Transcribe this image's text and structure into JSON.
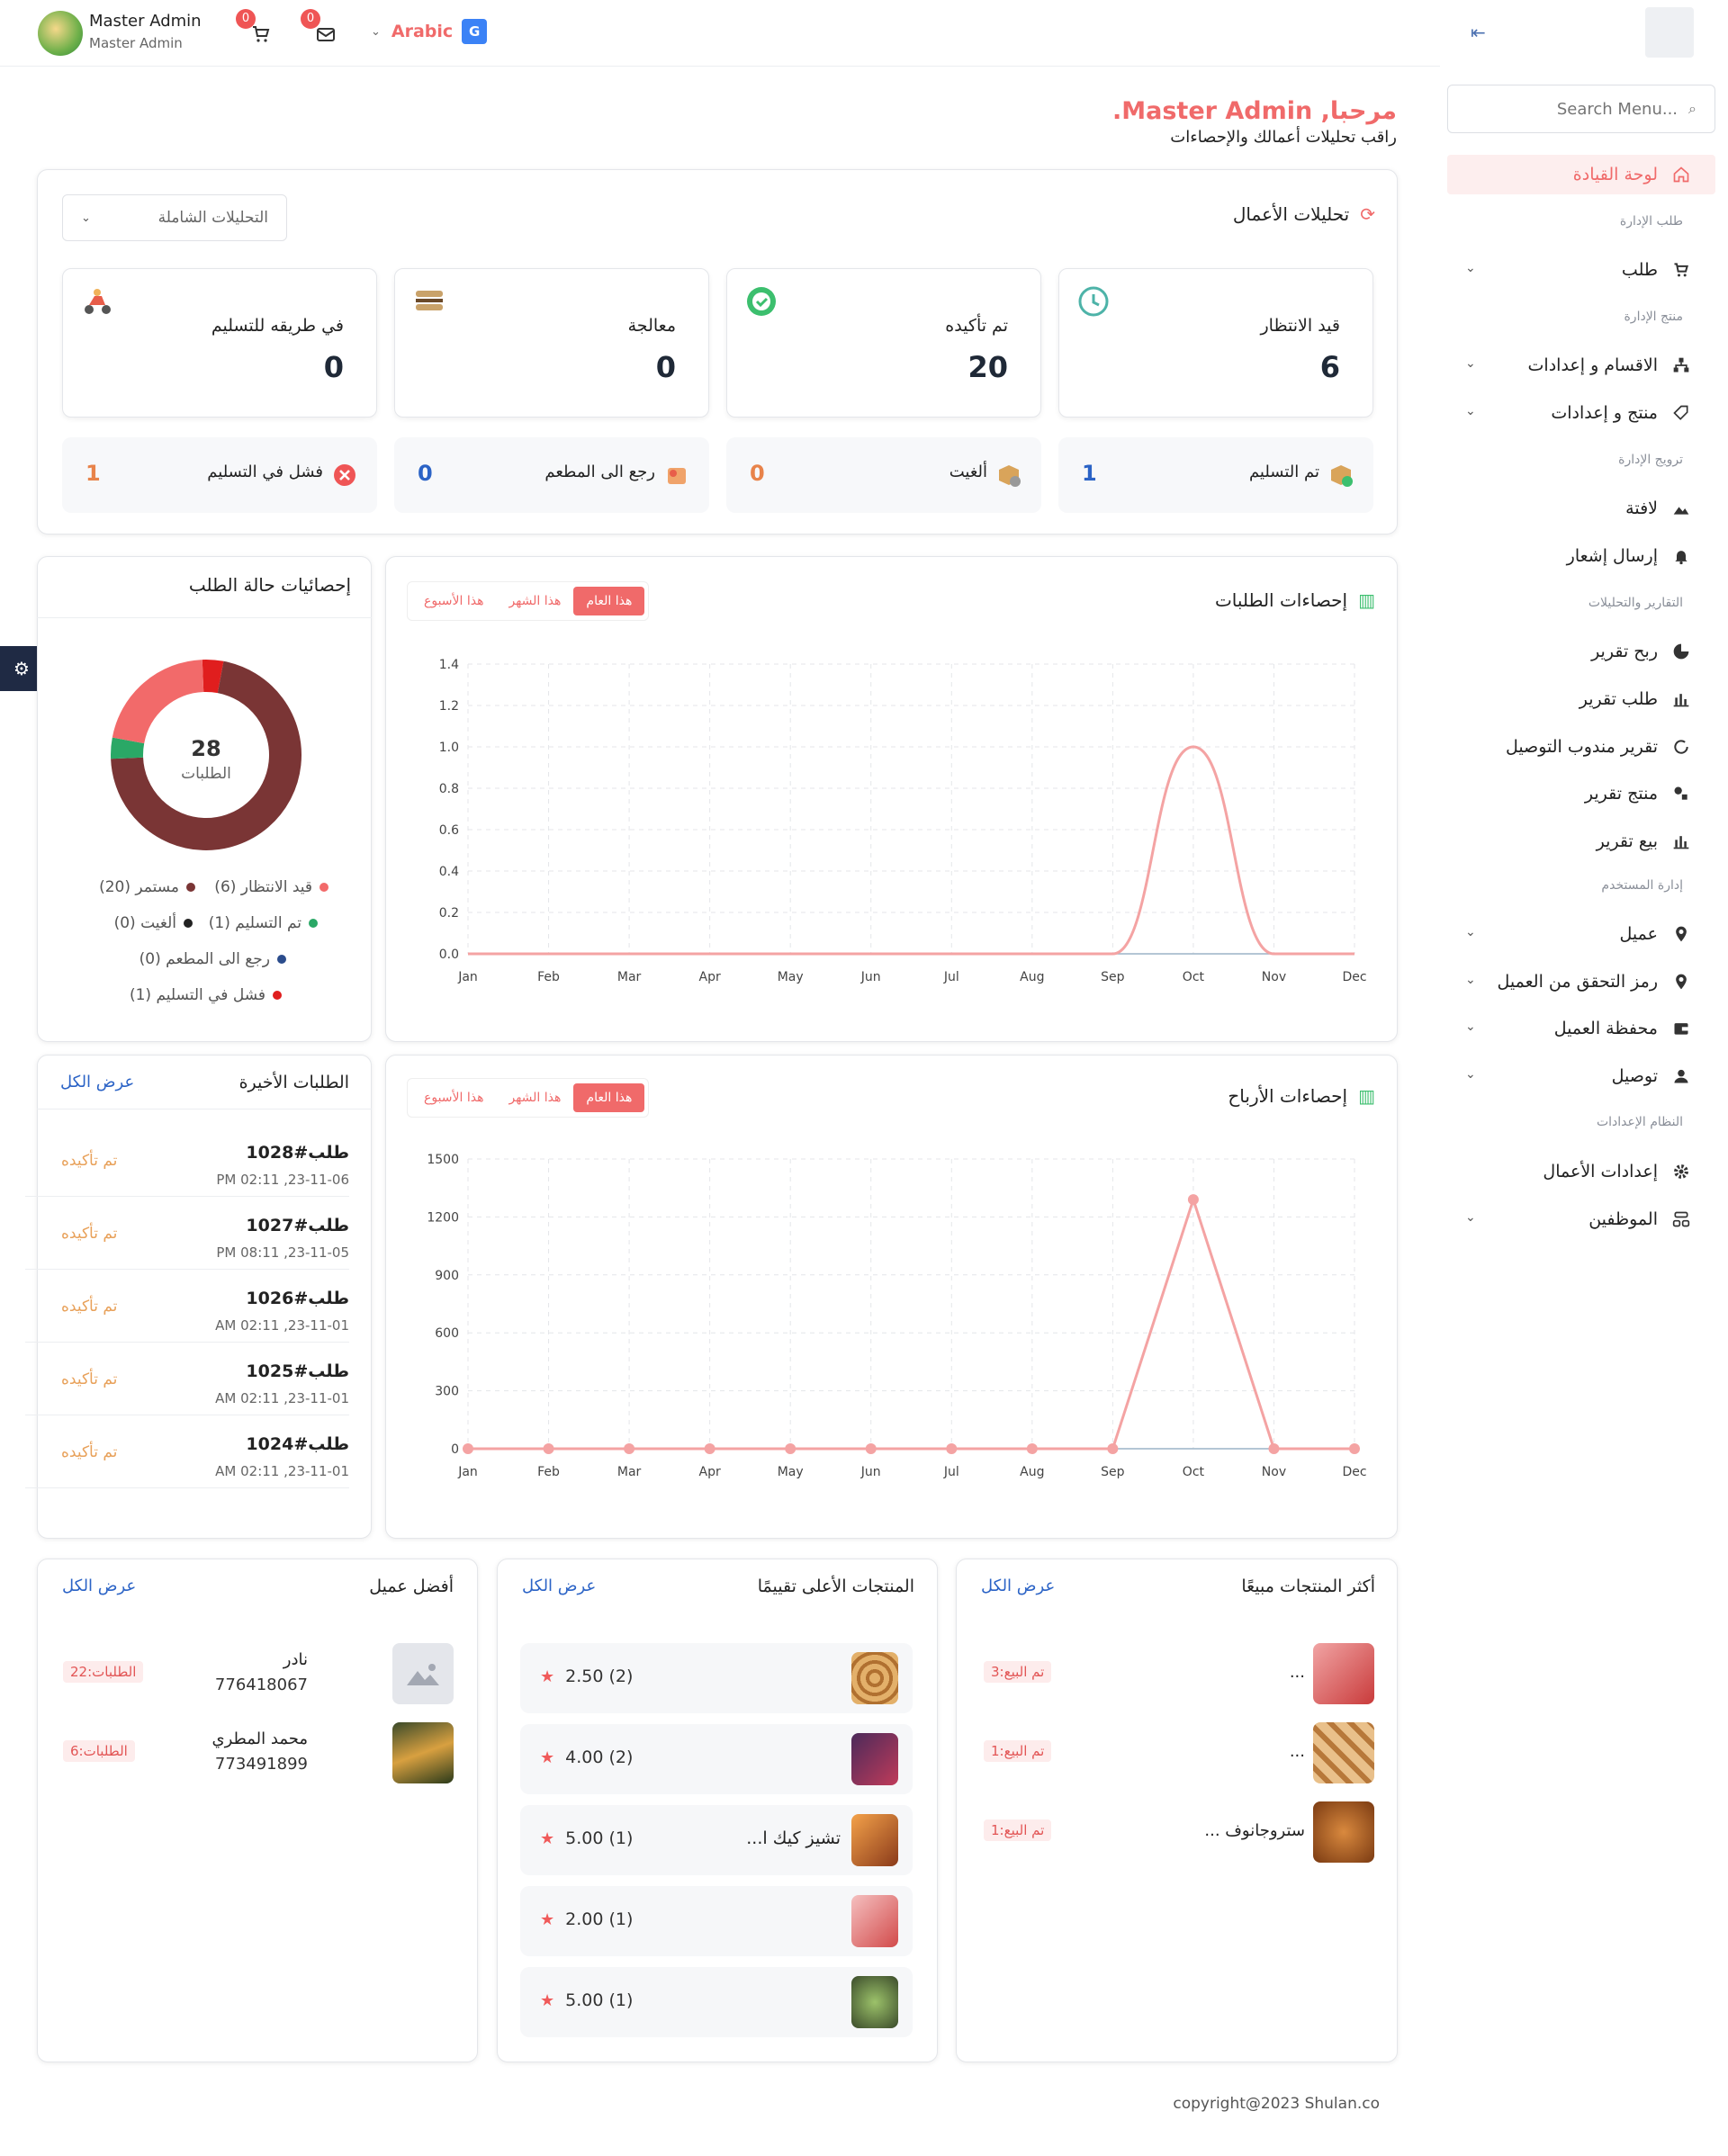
{
  "header": {
    "user_name": "Master Admin",
    "user_role": "Master Admin",
    "cart_count": "0",
    "message_count": "0",
    "language": "Arabic"
  },
  "sidebar": {
    "search_placeholder": "Search Menu...",
    "dashboard": "لوحة القيادة",
    "sections": {
      "orders": "طلب الإدارة",
      "products": "منتج الإدارة",
      "promo": "ترويج الإدارة",
      "reports": "التقارير والتحليلات",
      "users": "إدارة المستخدم",
      "system": "النظام الإعدادات"
    },
    "items": {
      "order": "طلب",
      "categories": "الاقسام و إعدادات",
      "product": "منتج و إعدادات",
      "banner": "لافتة",
      "notify": "إرسال إشعار",
      "profit_report": "ربح تقرير",
      "order_report": "طلب تقرير",
      "delivery_report": "تقرير مندوب التوصيل",
      "product_report": "منتج تقرير",
      "sale_report": "بيع تقرير",
      "customer": "عميل",
      "verify": "رمز التحقق من العميل",
      "wallet": "محفظة العميل",
      "delivery": "توصيل",
      "business_settings": "إعدادات الأعمال",
      "employees": "الموظفين"
    }
  },
  "welcome": {
    "greeting": "مرحبا, Master Admin.",
    "subtitle": "راقب تحليلات أعمالك والإحصاءات"
  },
  "analytics": {
    "title": "تحليلات الأعمال",
    "filter": "التحليلات الشاملة",
    "stats": [
      {
        "label": "قيد الانتظار",
        "value": "6"
      },
      {
        "label": "تم تأكيده",
        "value": "20"
      },
      {
        "label": "معالجة",
        "value": "0"
      },
      {
        "label": "في طريقه للتسليم",
        "value": "0"
      }
    ],
    "mini": [
      {
        "label": "تم التسليم",
        "value": "1",
        "color": "#2b63c6"
      },
      {
        "label": "ألغيت",
        "value": "0",
        "color": "#e8834a"
      },
      {
        "label": "رجع الى المطعم",
        "value": "0",
        "color": "#2b63c6"
      },
      {
        "label": "فشل في التسليم",
        "value": "1",
        "color": "#e8834a"
      }
    ]
  },
  "tabs": {
    "year": "هذا العام",
    "month": "هذا الشهر",
    "week": "هذا الأسبوع"
  },
  "orders_chart_title": "إحصاءات الطلبات",
  "profit_chart_title": "إحصاءات الأرباح",
  "chart_data": [
    {
      "type": "line",
      "x": [
        "Jan",
        "Feb",
        "Mar",
        "Apr",
        "May",
        "Jun",
        "Jul",
        "Aug",
        "Sep",
        "Oct",
        "Nov",
        "Dec"
      ],
      "series": [
        {
          "values": [
            0,
            0,
            0,
            0,
            0,
            0,
            0,
            0,
            0,
            1,
            0,
            0
          ],
          "color": "#f4a3a3"
        }
      ],
      "ylim": [
        0,
        1.4
      ],
      "yticks": [
        "0.0",
        "0.2",
        "0.4",
        "0.6",
        "0.8",
        "1.0",
        "1.2",
        "1.4"
      ],
      "smooth": true
    },
    {
      "type": "line",
      "x": [
        "Jan",
        "Feb",
        "Mar",
        "Apr",
        "May",
        "Jun",
        "Jul",
        "Aug",
        "Sep",
        "Oct",
        "Nov",
        "Dec"
      ],
      "series": [
        {
          "values": [
            0,
            0,
            0,
            0,
            0,
            0,
            0,
            0,
            0,
            1290,
            0,
            0
          ],
          "color": "#f4a3a3"
        }
      ],
      "ylim": [
        0,
        1500
      ],
      "yticks": [
        "0",
        "300",
        "600",
        "900",
        "1200",
        "1500"
      ],
      "smooth": false
    },
    {
      "type": "pie",
      "title": "إحصائيات حالة الطلب",
      "total": "28",
      "total_label": "الطلبات",
      "slices": [
        {
          "label": "مستمر",
          "value": 20,
          "color": "#7a3535"
        },
        {
          "label": "قيد الانتظار",
          "value": 6,
          "color": "#f26a6a"
        },
        {
          "label": "تم التسليم",
          "value": 1,
          "color": "#2aa866"
        },
        {
          "label": "ألغيت",
          "value": 0,
          "color": "#222222"
        },
        {
          "label": "رجع الى المطعم",
          "value": 0,
          "color": "#2b4c8c"
        },
        {
          "label": "فشل في التسليم",
          "value": 1,
          "color": "#e01e1e"
        }
      ]
    }
  ],
  "legend": {
    "l1a": "قيد الانتظار (6)",
    "l1b": "مستمر (20)",
    "l2a": "تم التسليم (1)",
    "l2b": "ألغيت (0)",
    "l3": "رجع الى المطعم (0)",
    "l4": "فشل في التسليم (1)"
  },
  "recent": {
    "title": "الطلبات الأخيرة",
    "view_all": "عرض الكل",
    "rows": [
      {
        "id": "طلب#1028",
        "date": "23-11-06, 02:11 PM",
        "status": "تم تأكيده"
      },
      {
        "id": "طلب#1027",
        "date": "23-11-05, 08:11 PM",
        "status": "تم تأكيده"
      },
      {
        "id": "طلب#1026",
        "date": "23-11-01, 02:11 AM",
        "status": "تم تأكيده"
      },
      {
        "id": "طلب#1025",
        "date": "23-11-01, 02:11 AM",
        "status": "تم تأكيده"
      },
      {
        "id": "طلب#1024",
        "date": "23-11-01, 02:11 AM",
        "status": "تم تأكيده"
      }
    ]
  },
  "best_selling": {
    "title": "أكثر المنتجات مبيعًا",
    "view_all": "عرض الكل",
    "rows": [
      {
        "name": "...",
        "sold": "تم البيع:3"
      },
      {
        "name": "...",
        "sold": "تم البيع:1"
      },
      {
        "name": "ستروجانوف ...",
        "sold": "تم البيع:1"
      }
    ]
  },
  "top_rated": {
    "title": "المنتجات الأعلى تقييمًا",
    "view_all": "عرض الكل",
    "rows": [
      {
        "name": "",
        "rating": "2.50 (2)"
      },
      {
        "name": "",
        "rating": "4.00 (2)"
      },
      {
        "name": "تشيز كيك ا...",
        "rating": "5.00 (1)"
      },
      {
        "name": "",
        "rating": "2.00 (1)"
      },
      {
        "name": "",
        "rating": "5.00 (1)"
      }
    ]
  },
  "top_customers": {
    "title": "أفضل عميل",
    "view_all": "عرض الكل",
    "rows": [
      {
        "name": "نادر",
        "phone": "776418067",
        "orders": "الطلبات:22"
      },
      {
        "name": "محمد المطري",
        "phone": "773491899",
        "orders": "الطلبات:6"
      }
    ]
  },
  "footer": "copyright@2023 Shulan.co"
}
